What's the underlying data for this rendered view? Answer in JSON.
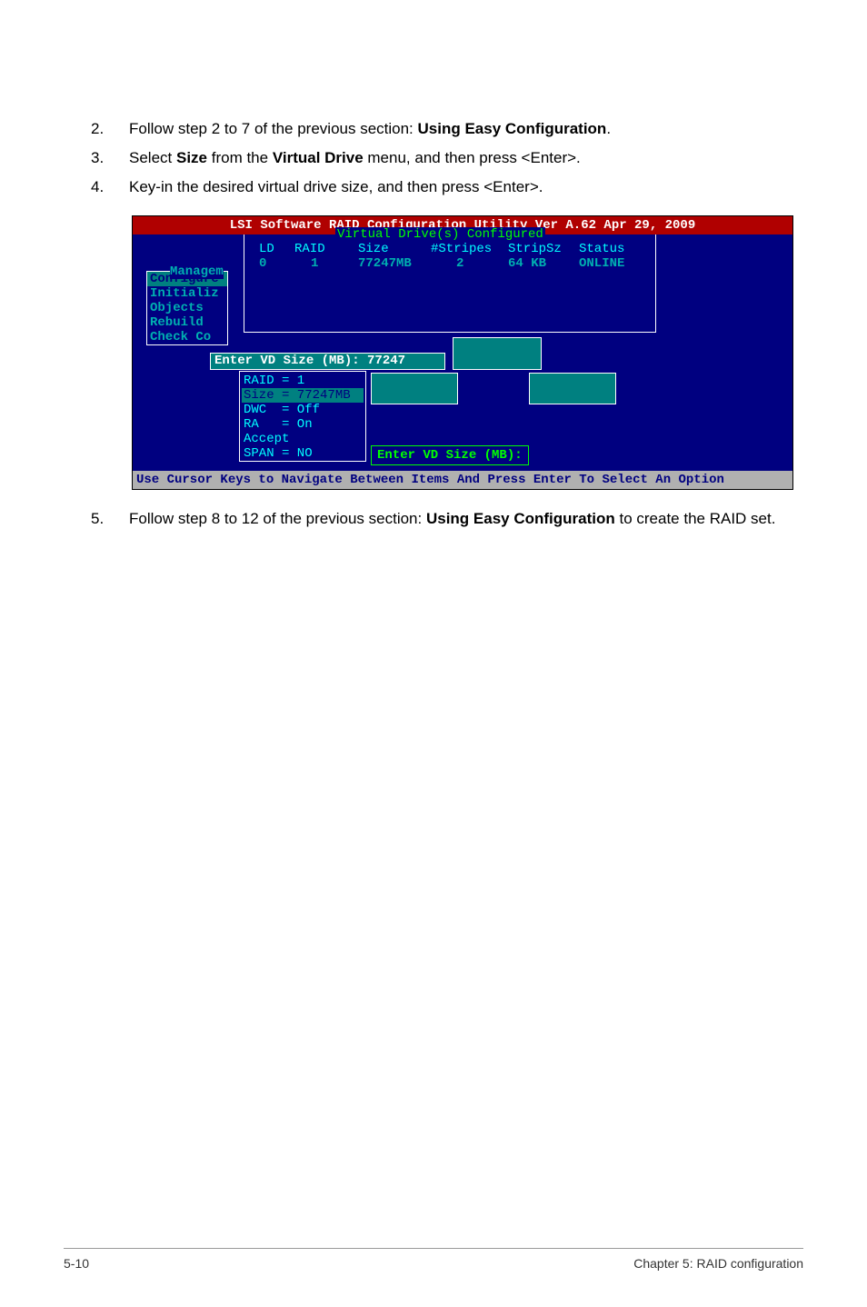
{
  "steps": {
    "s2": {
      "num": "2.",
      "pre": "Follow step 2 to 7 of the previous section: ",
      "bold1": "Using Easy Configuration",
      "post": "."
    },
    "s3": {
      "num": "3.",
      "pre": "Select ",
      "bold1": "Size",
      "mid": " from the ",
      "bold2": "Virtual Drive",
      "post": " menu, and then press <Enter>."
    },
    "s4": {
      "num": "4.",
      "text": "Key-in the desired virtual drive size, and then press <Enter>."
    },
    "s5": {
      "num": "5.",
      "pre": "Follow step 8 to 12 of the previous section: ",
      "bold1": "Using Easy Configuration",
      "post": " to create the RAID set."
    }
  },
  "screenshot": {
    "title": "LSI Software RAID Configuration Utility Ver A.62 Apr 29, 2009",
    "vd_title": "Virtual Drive(s) Configured",
    "headers": {
      "ld": "LD",
      "raid": "RAID",
      "size": "Size",
      "stripes": "#Stripes",
      "stripsz": "StripSz",
      "status": "Status"
    },
    "data": {
      "ld": "0",
      "raid": "1",
      "size": "77247MB",
      "stripes": "2",
      "stripsz": "64 KB",
      "status": "ONLINE"
    },
    "sidebar_title": "Managem",
    "sidebar": [
      "Configure",
      "Initializ",
      "Objects",
      "Rebuild",
      "Check Co"
    ],
    "enter_vd": "Enter VD Size (MB): 77247",
    "config": {
      "raid": "RAID = 1",
      "size": "Size = 77247MB",
      "dwc": "DWC  = Off",
      "ra": "RA   = On",
      "accept": "Accept",
      "span": "SPAN = NO"
    },
    "prompt": "Enter VD Size (MB):",
    "footer_bar": "Use Cursor Keys to Navigate Between Items And Press Enter To Select An Option"
  },
  "footer": {
    "left": "5-10",
    "right": "Chapter 5: RAID configuration"
  }
}
